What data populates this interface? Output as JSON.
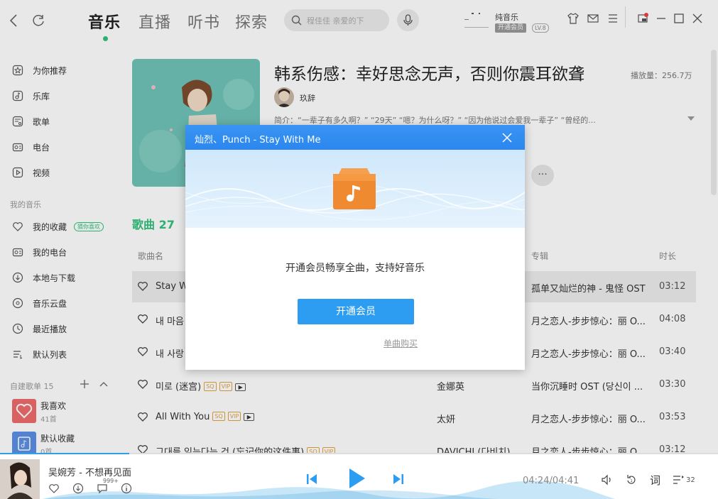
{
  "nav": {
    "tabs": [
      "音乐",
      "直播",
      "听书",
      "探索"
    ],
    "search_placeholder": "程佳佳 亲爱的下",
    "user": {
      "name": "纯音乐",
      "vip_label": "开通会员",
      "level": "LV.8"
    }
  },
  "sidebar": {
    "main_items": [
      "为你推荐",
      "乐库",
      "歌单",
      "电台",
      "视频"
    ],
    "my_music_caption": "我的音乐",
    "my_items": [
      "我的收藏",
      "我的电台",
      "本地与下载",
      "音乐云盘",
      "最近播放",
      "默认列表"
    ],
    "guess_badge": "猜你喜欢",
    "created_caption": "自建歌单 15",
    "playlists": [
      {
        "title": "我喜欢",
        "count": "41首"
      },
      {
        "title": "默认收藏",
        "count": "0首"
      }
    ]
  },
  "playlist": {
    "title": "韩系伤感：幸好思念无声，否则你震耳欲聋",
    "plays": "播放量：256.7万",
    "creator": "玖辞",
    "intro": "简介：“一辈子有多久啊？”  “29天”  “嗯？为什么呀？”  “因为他说过会爱我一辈子”  “曾经的...",
    "more": "···"
  },
  "songs_header": {
    "label": "歌曲",
    "count": "27"
  },
  "columns": {
    "name": "歌曲名",
    "album": "专辑",
    "duration": "时长"
  },
  "songs": [
    {
      "name": "Stay W",
      "artist": "",
      "album": "孤单又灿烂的神 - 鬼怪 OST",
      "duration": "03:12"
    },
    {
      "name": "내 마음",
      "artist": "",
      "album": "月之恋人-步步惊心：丽 O...",
      "duration": "04:08"
    },
    {
      "name": "내 사랑",
      "artist": "",
      "album": "月之恋人-步步惊心：丽 O...",
      "duration": "03:40"
    },
    {
      "name": "미로 (迷宫)",
      "artist": "金娜英",
      "album": "当你沉睡时 OST (당신이 ...",
      "duration": "03:30"
    },
    {
      "name": "All With You",
      "artist": "太妍",
      "album": "月之恋人-步步惊心：丽 O...",
      "duration": "03:53"
    },
    {
      "name": "그대를 잊는다는 건 (忘记你的这件事)",
      "artist": "DAVICHI (다비치)",
      "album": "月之恋人-步步惊心：丽 O...",
      "duration": "03:12"
    }
  ],
  "tags": {
    "sq": "SQ",
    "vip": "VIP",
    "mv": "▶"
  },
  "dialog": {
    "title": "灿烈、Punch - Stay With Me",
    "message": "开通会员畅享全曲，支持好音乐",
    "open_button": "开通会员",
    "buy_link": "单曲购买"
  },
  "player": {
    "song": "吴婉芳 - 不想再见面",
    "comments": "999+",
    "time": "04:24/04:41",
    "lyrics_label": "词",
    "queue_count": "32",
    "progress": 0.18
  },
  "colors": {
    "accent": "#31c27c",
    "dialog_header": "#2d8cf0",
    "button": "#2c9df0",
    "folder": "#f08a30"
  }
}
